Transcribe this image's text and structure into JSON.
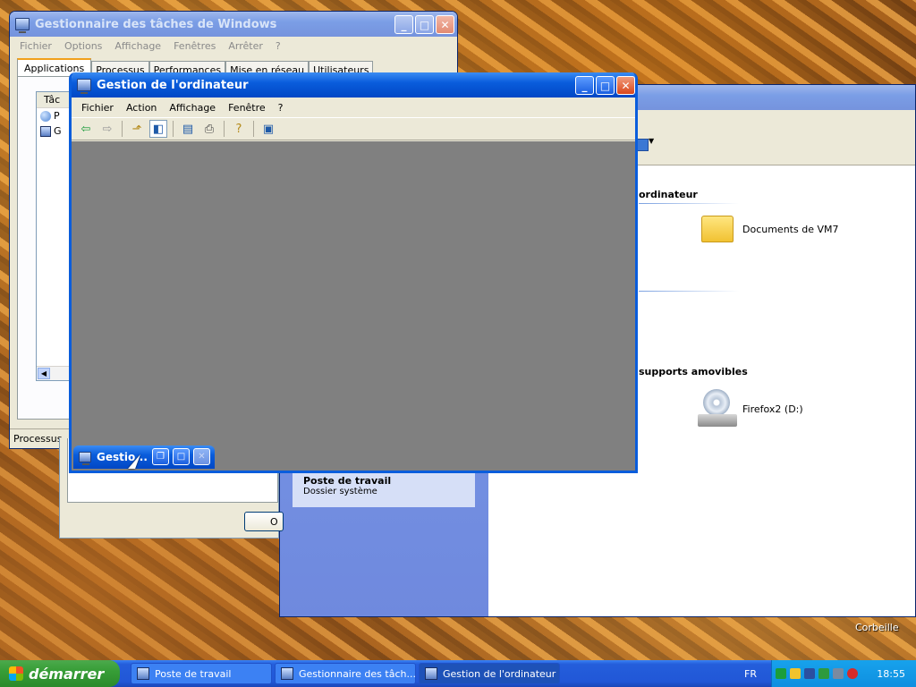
{
  "taskmgr": {
    "title": "Gestionnaire des tâches de Windows",
    "menu": [
      "Fichier",
      "Options",
      "Affichage",
      "Fenêtres",
      "Arrêter",
      "?"
    ],
    "tabs": [
      "Applications",
      "Processus",
      "Performances",
      "Mise en réseau",
      "Utilisateurs"
    ],
    "col_header": "Tâc",
    "rows": [
      "P",
      "G"
    ],
    "status": "Processus"
  },
  "explorer": {
    "section1": "ordinateur",
    "folder_label": "Documents de VM7",
    "section2": "supports amovibles",
    "drive_label": "Firefox2 (D:)",
    "details_title": "Poste de travail",
    "details_sub": "Dossier système"
  },
  "dialog_btn": "O",
  "compmgmt": {
    "title": "Gestion de l'ordinateur",
    "menu": [
      "Fichier",
      "Action",
      "Affichage",
      "Fenêtre",
      "?"
    ]
  },
  "minimized": {
    "label": "Gestio..."
  },
  "desktop": {
    "recycle_label": "Corbeille"
  },
  "taskbar": {
    "start_label": "démarrer",
    "tasks": [
      "Poste de travail",
      "Gestionnaire des tâch...",
      "Gestion de l'ordinateur"
    ],
    "lang": "FR",
    "clock": "18:55"
  }
}
